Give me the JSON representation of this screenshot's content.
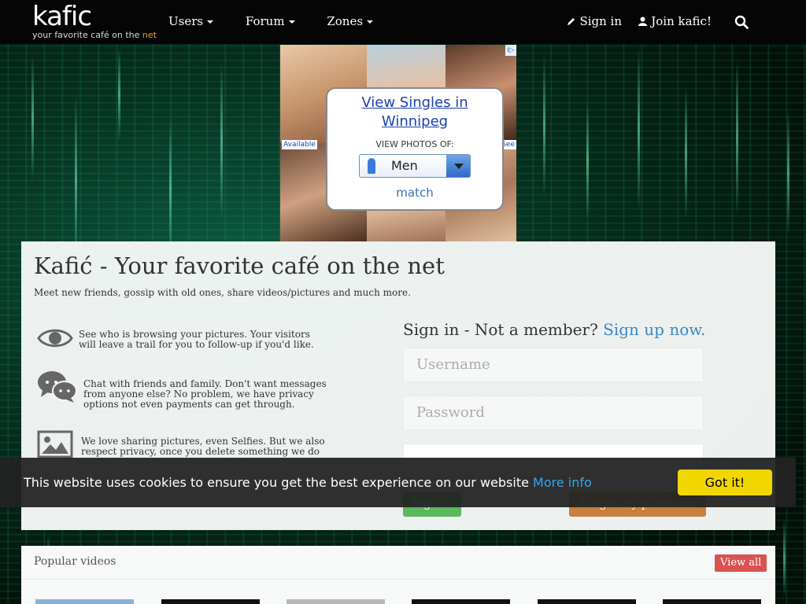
{
  "nav": {
    "logo": "kafic",
    "tagline_pre": "your favorite café on the ",
    "tagline_net": "net",
    "menu": [
      {
        "label": "Users"
      },
      {
        "label": "Forum"
      },
      {
        "label": "Zones"
      }
    ],
    "sign_in": "Sign in",
    "join": "Join kafic!"
  },
  "ad": {
    "headline": "View Singles in Winnipeg",
    "prompt": "VIEW PHOTOS OF:",
    "select_value": "Men",
    "brand": "match",
    "available": "Available",
    "see": "See",
    "choices": "i▷"
  },
  "main": {
    "title": "Kafić - Your favorite café on the net",
    "subtitle": "Meet new friends, gossip with old ones, share videos/pictures and much more.",
    "features": [
      "See who is browsing your pictures. Your visitors will leave a trail for you to follow-up if you'd like.",
      "Chat with friends and family. Don't want messages from anyone else? No problem, we have privacy options not even payments can get through.",
      "We love sharing pictures, even Selfies. But we also respect privacy, once you delete something we do"
    ],
    "signin_prefix": "Sign in - Not a member? ",
    "signup_link": "Sign up now.",
    "username_placeholder": "Username",
    "password_placeholder": "Password",
    "signin_button": "Sign in",
    "forgot_button": "Forgot my password"
  },
  "videos": {
    "title": "Popular videos",
    "view_all": "View all"
  },
  "cookie": {
    "message": "This website uses cookies to ensure you get the best experience on our website",
    "more_info": "More info",
    "accept": "Got it!"
  }
}
